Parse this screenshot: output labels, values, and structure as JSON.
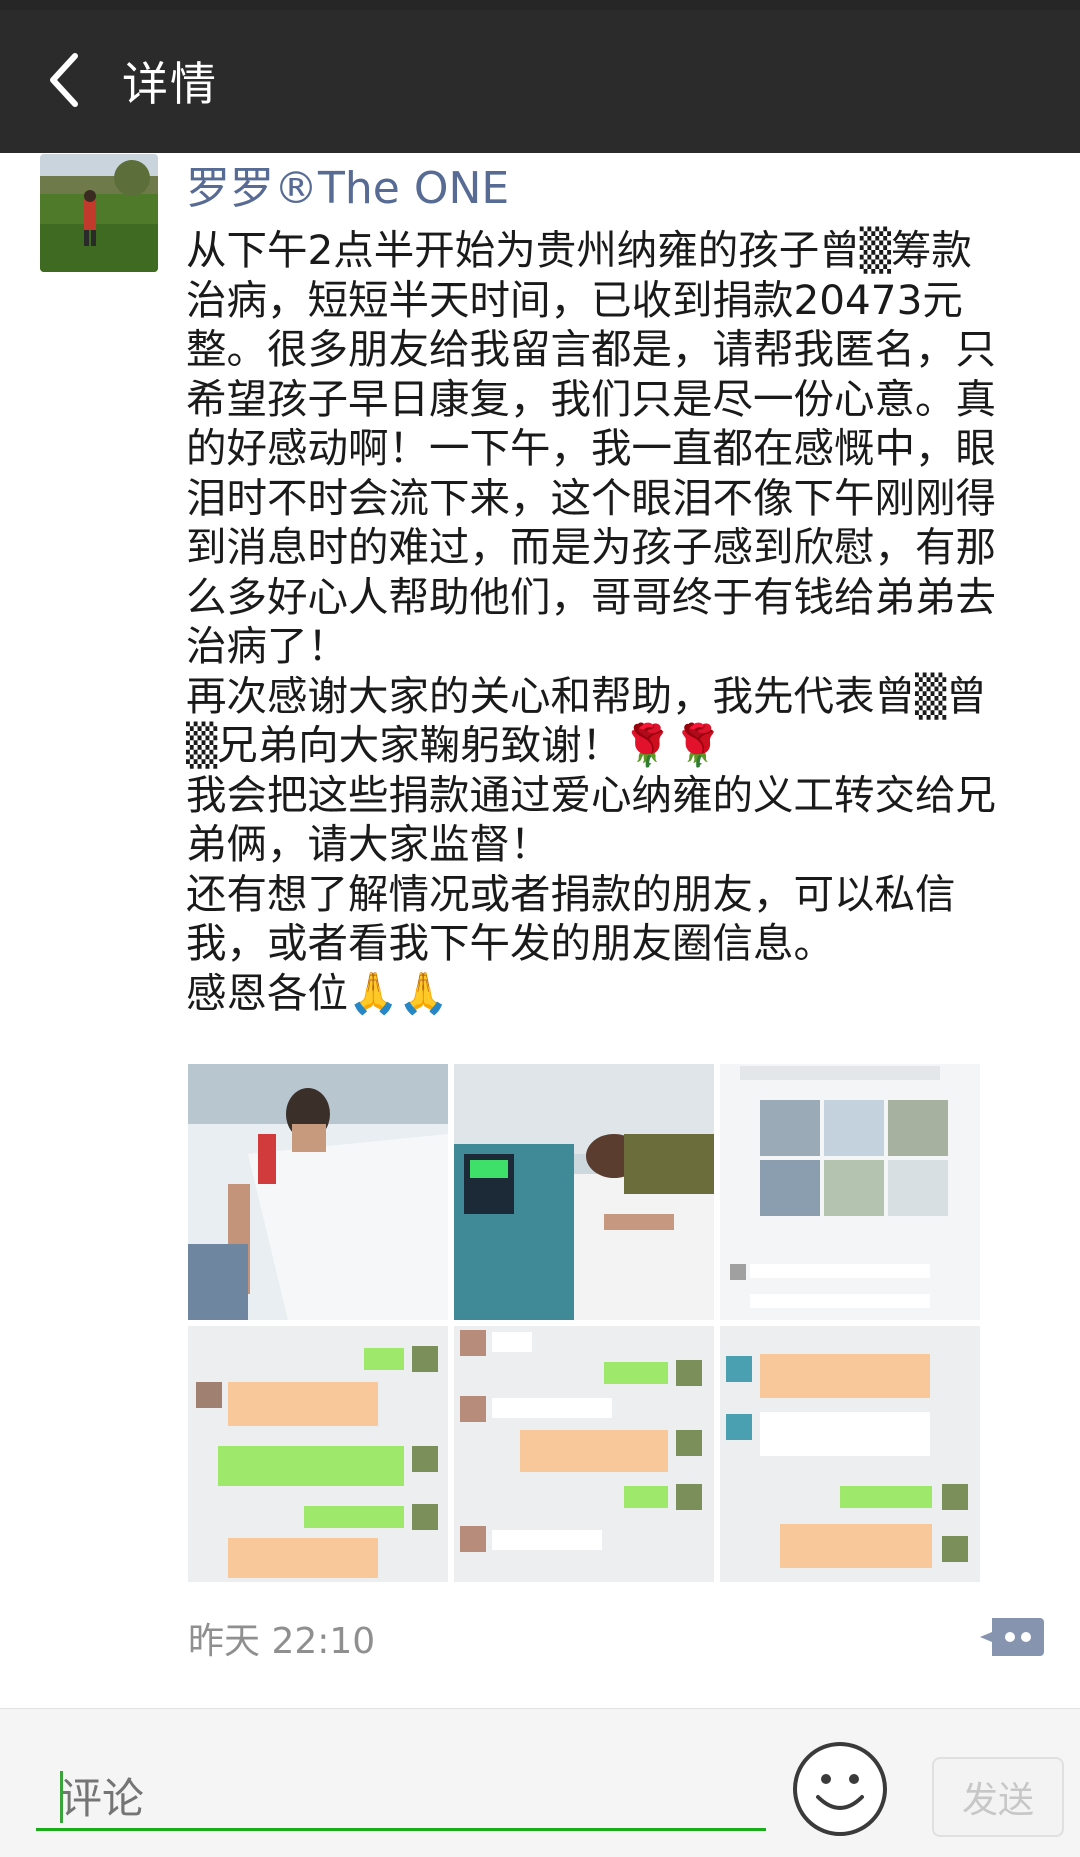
{
  "header": {
    "title": "详情",
    "back_icon": "chevron-left-icon"
  },
  "post": {
    "author": "罗罗®The ONE",
    "text_lines": [
      "从下午2点半开始为贵州纳雍的孩子曾▒筹款",
      "治病，短短半天时间，已收到捐款20473元",
      "整。很多朋友给我留言都是，请帮我匿名，只",
      "希望孩子早日康复，我们只是尽一份心意。真",
      "的好感动啊！一下午，我一直都在感慨中，眼",
      "泪时不时会流下来，这个眼泪不像下午刚刚得",
      "到消息时的难过，而是为孩子感到欣慰，有那",
      "么多好心人帮助他们，哥哥终于有钱给弟弟去",
      "治病了！",
      "再次感谢大家的关心和帮助，我先代表曾▒曾",
      "▒兄弟向大家鞠躬致谢！🌹🌹",
      "我会把这些捐款通过爱心纳雍的义工转交给兄",
      "弟俩，请大家监督！",
      "还有想了解情况或者捐款的朋友，可以私信",
      "我，或者看我下午发的朋友圈信息。",
      "感恩各位🙏🙏"
    ],
    "timestamp": "昨天 22:10",
    "comment_icon": "comment-bubble-icon"
  },
  "images": [
    {
      "name": "photo-hospital-bed-1"
    },
    {
      "name": "photo-hospital-bed-2"
    },
    {
      "name": "screenshot-chat-collage"
    },
    {
      "name": "screenshot-chat-1"
    },
    {
      "name": "screenshot-chat-2"
    },
    {
      "name": "screenshot-chat-3"
    }
  ],
  "comment_bar": {
    "placeholder": "评论",
    "emoji_icon": "smiley-face-icon",
    "send_label": "发送"
  },
  "colors": {
    "header_bg": "#2b2b2b",
    "author_link": "#576b95",
    "timestamp": "#8f8f8f",
    "input_underline": "#1aad19"
  }
}
